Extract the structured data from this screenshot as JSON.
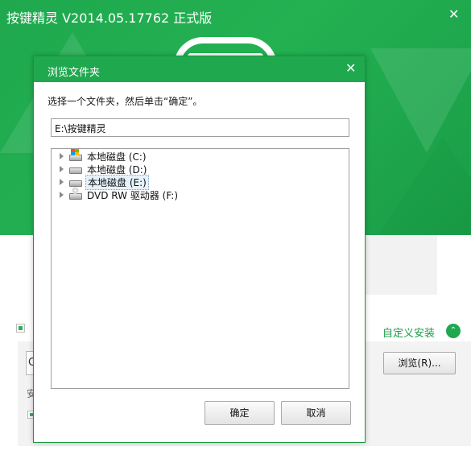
{
  "app": {
    "title": "按键精灵 V2014.05.17762 正式版",
    "close_glyph": "✕",
    "brand_color": "#1fa84e"
  },
  "installer": {
    "custom_install_label": "自定义安装",
    "collapse_glyph": "⌃",
    "path_partial": "C",
    "browse_label": "浏览(R)...",
    "partial_label": "安"
  },
  "dialog": {
    "title": "浏览文件夹",
    "close_glyph": "✕",
    "prompt": "选择一个文件夹，然后单击“确定”。",
    "path_value": "E:\\按键精灵",
    "tree": [
      {
        "label": "本地磁盘 (C:)",
        "icon": "system-drive-icon",
        "selected": false
      },
      {
        "label": "本地磁盘 (D:)",
        "icon": "hard-drive-icon",
        "selected": false
      },
      {
        "label": "本地磁盘 (E:)",
        "icon": "hard-drive-icon",
        "selected": true
      },
      {
        "label": "DVD RW 驱动器 (F:)",
        "icon": "dvd-drive-icon",
        "selected": false
      }
    ],
    "ok_label": "确定",
    "cancel_label": "取消"
  }
}
